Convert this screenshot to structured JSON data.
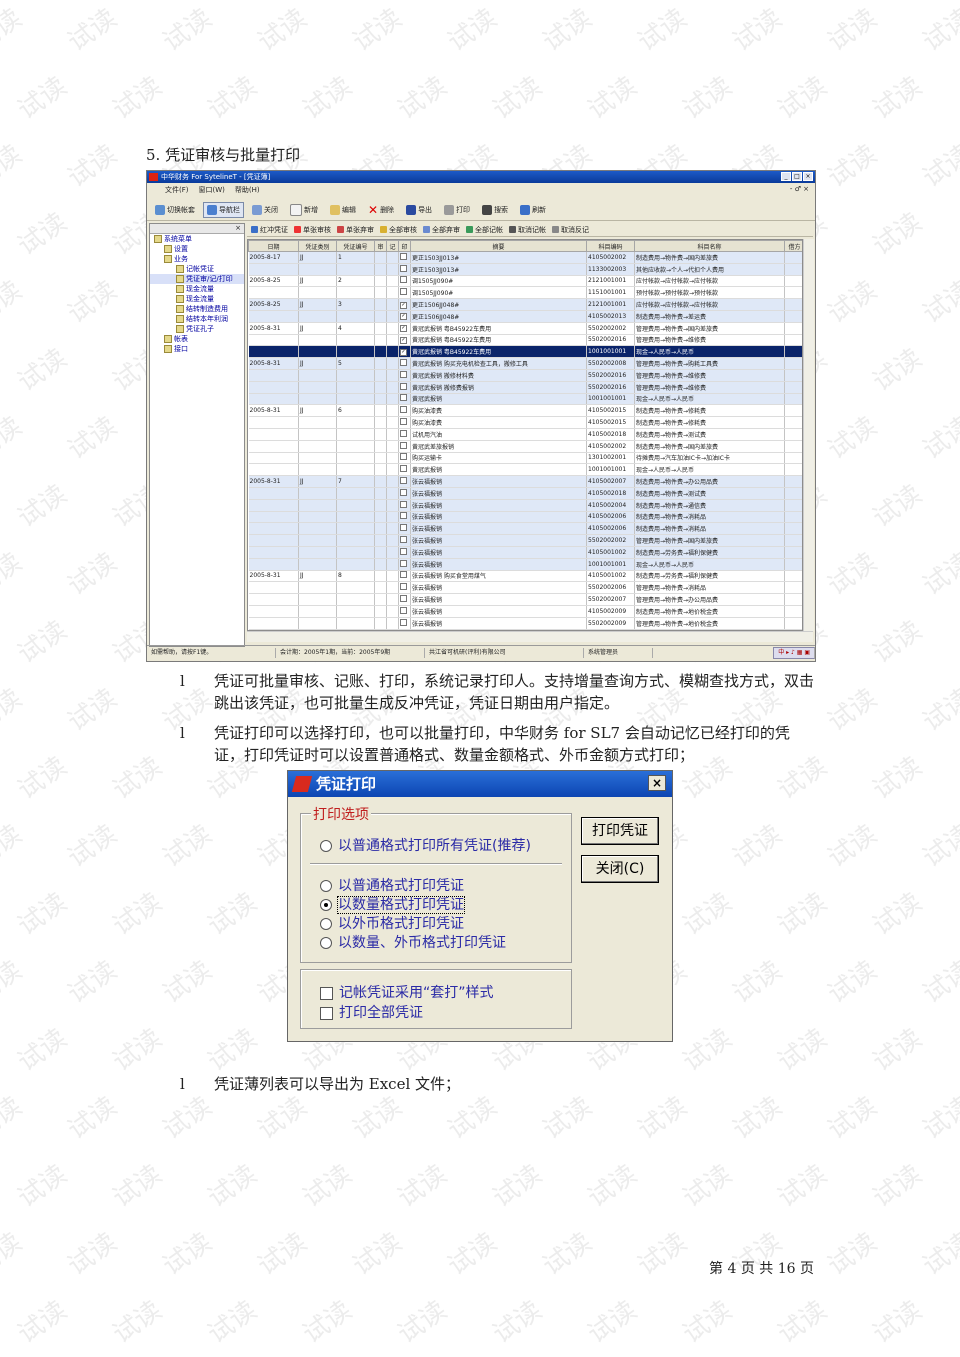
{
  "watermark": "试读",
  "heading": "5. 凭证审核与批量打印",
  "app": {
    "title": "中华财务 For SytelineT - [凭证簿]",
    "window_buttons": [
      "_",
      "□",
      "×"
    ],
    "menus": [
      "文件(F)",
      "窗口(W)",
      "帮助(H)"
    ],
    "mdi_buttons": "- ♂ ×",
    "toolbar": [
      "切换帐套",
      "导航栏",
      "关闭",
      "新增",
      "编辑",
      "删除",
      "导出",
      "打印",
      "搜索",
      "刷新"
    ],
    "sidebar": {
      "close": "×",
      "tree": [
        {
          "label": "系统菜单",
          "level": 1
        },
        {
          "label": "设置",
          "level": 2
        },
        {
          "label": "业务",
          "level": 2
        },
        {
          "label": "记帐凭证",
          "level": 3
        },
        {
          "label": "凭证审/记/打印",
          "level": 3
        },
        {
          "label": "现金流量",
          "level": 3
        },
        {
          "label": "现金流量",
          "level": 3
        },
        {
          "label": "结转制造费用",
          "level": 3
        },
        {
          "label": "结转本年利润",
          "level": 3
        },
        {
          "label": "凭证孔子",
          "level": 3
        },
        {
          "label": "帐表",
          "level": 2
        },
        {
          "label": "接口",
          "level": 2
        }
      ]
    },
    "toolbar2": [
      "红冲凭证",
      "单张审核",
      "单张弃审",
      "全部审核",
      "全部弃审",
      "全部记帐",
      "取消记帐",
      "取消反记"
    ],
    "columns": [
      "日期",
      "凭证类别",
      "凭证编号",
      "审",
      "记",
      "印",
      "摘要",
      "科目编码",
      "科目名称",
      "借方"
    ],
    "rows": [
      {
        "date": "2005-8-17",
        "type": "JJ",
        "no": "1",
        "check": "",
        "summary": "更正1503JJ013#",
        "code": "4105002002",
        "name": "制造费用→物件费→国内差旅费",
        "grp": true
      },
      {
        "date": "",
        "type": "",
        "no": "",
        "check": "",
        "summary": "更正1503JJ013#",
        "code": "1133002003",
        "name": "其他应收款→个人→代扣个人费用",
        "grp": true
      },
      {
        "date": "2005-8-25",
        "type": "JJ",
        "no": "2",
        "check": "",
        "summary": "调1505JJ090#",
        "code": "2121001001",
        "name": "应付帐款→应付帐款→应付帐款",
        "grp": false
      },
      {
        "date": "",
        "type": "",
        "no": "",
        "check": "",
        "summary": "调1505JJ090#",
        "code": "1151001001",
        "name": "预付帐款→预付帐款→预付帐款",
        "grp": false
      },
      {
        "date": "2005-8-25",
        "type": "JJ",
        "no": "3",
        "check": "✓",
        "summary": "更正1506JJ048#",
        "code": "2121001001",
        "name": "应付帐款→应付帐款→应付帐款",
        "grp": true
      },
      {
        "date": "",
        "type": "",
        "no": "",
        "check": "✓",
        "summary": "更正1506JJ048#",
        "code": "4105002013",
        "name": "制造费用→物件费→差运费",
        "grp": true
      },
      {
        "date": "2005-8-31",
        "type": "JJ",
        "no": "4",
        "check": "✓",
        "summary": "黄冠武报销 粤B45922车费用",
        "code": "5502002002",
        "name": "管理费用→物件费→国内差旅费",
        "grp": false
      },
      {
        "date": "",
        "type": "",
        "no": "",
        "check": "✓",
        "summary": "黄冠武报销 粤B45922车费用",
        "code": "5502002016",
        "name": "管理费用→物件费→维修费",
        "grp": false
      },
      {
        "date": "",
        "type": "",
        "no": "",
        "check": "✓",
        "summary": "黄冠武报销 粤B45922车费用",
        "code": "1001001001",
        "name": "现金→人民币→人民币",
        "grp": false,
        "hl": true
      },
      {
        "date": "2005-8-31",
        "type": "JJ",
        "no": "5",
        "check": "",
        "summary": "黄冠武报销 购买充电机检查工具，搬修工具",
        "code": "5502002008",
        "name": "管理费用→物件费→购耗工具费",
        "grp": true
      },
      {
        "date": "",
        "type": "",
        "no": "",
        "check": "",
        "summary": "黄冠武报销 搬修材料费",
        "code": "5502002016",
        "name": "管理费用→物件费→维修费",
        "grp": true
      },
      {
        "date": "",
        "type": "",
        "no": "",
        "check": "",
        "summary": "黄冠武报销 搬修费报销",
        "code": "5502002016",
        "name": "管理费用→物件费→维修费",
        "grp": true
      },
      {
        "date": "",
        "type": "",
        "no": "",
        "check": "",
        "summary": "黄冠武报销",
        "code": "1001001001",
        "name": "现金→人民币→人民币",
        "grp": true
      },
      {
        "date": "2005-8-31",
        "type": "JJ",
        "no": "6",
        "check": "",
        "summary": "购买油漆费",
        "code": "4105002015",
        "name": "制造费用→物件费→修耗费",
        "grp": false
      },
      {
        "date": "",
        "type": "",
        "no": "",
        "check": "",
        "summary": "购买油漆费",
        "code": "4105002015",
        "name": "制造费用→物件费→修耗费",
        "grp": false
      },
      {
        "date": "",
        "type": "",
        "no": "",
        "check": "",
        "summary": "试机用汽油",
        "code": "4105002018",
        "name": "制造费用→物件费→测试费",
        "grp": false
      },
      {
        "date": "",
        "type": "",
        "no": "",
        "check": "",
        "summary": "黄冠武差旅报销",
        "code": "4105002002",
        "name": "制造费用→物件费→国内差旅费",
        "grp": false
      },
      {
        "date": "",
        "type": "",
        "no": "",
        "check": "",
        "summary": "购买运输卡",
        "code": "1301002001",
        "name": "待摊费用→汽车加油IC卡→加油IC卡",
        "grp": false
      },
      {
        "date": "",
        "type": "",
        "no": "",
        "check": "",
        "summary": "黄冠武报销",
        "code": "1001001001",
        "name": "现金→人民币→人民币",
        "grp": false
      },
      {
        "date": "2005-8-31",
        "type": "JJ",
        "no": "7",
        "check": "",
        "summary": "张云福报销",
        "code": "4105002007",
        "name": "制造费用→物件费→办公用品费",
        "grp": true
      },
      {
        "date": "",
        "type": "",
        "no": "",
        "check": "",
        "summary": "张云福报销",
        "code": "4105002018",
        "name": "制造费用→物件费→测试费",
        "grp": true
      },
      {
        "date": "",
        "type": "",
        "no": "",
        "check": "",
        "summary": "张云福报销",
        "code": "4105002004",
        "name": "制造费用→物件费→通信费",
        "grp": true
      },
      {
        "date": "",
        "type": "",
        "no": "",
        "check": "",
        "summary": "张云福报销",
        "code": "4105002006",
        "name": "制造费用→物件费→消耗品",
        "grp": true
      },
      {
        "date": "",
        "type": "",
        "no": "",
        "check": "",
        "summary": "张云福报销",
        "code": "4105002006",
        "name": "制造费用→物件费→消耗品",
        "grp": true
      },
      {
        "date": "",
        "type": "",
        "no": "",
        "check": "",
        "summary": "张云福报销",
        "code": "5502002002",
        "name": "管理费用→物件费→国内差旅费",
        "grp": true
      },
      {
        "date": "",
        "type": "",
        "no": "",
        "check": "",
        "summary": "张云福报销",
        "code": "4105001002",
        "name": "制造费用→劳务费→福利保健费",
        "grp": true
      },
      {
        "date": "",
        "type": "",
        "no": "",
        "check": "",
        "summary": "张云福报销",
        "code": "1001001001",
        "name": "现金→人民币→人民币",
        "grp": true
      },
      {
        "date": "2005-8-31",
        "type": "JJ",
        "no": "8",
        "check": "",
        "summary": "张云福报销 购买食堂用煤气",
        "code": "4105001002",
        "name": "制造费用→劳务费→福利保健费",
        "grp": false
      },
      {
        "date": "",
        "type": "",
        "no": "",
        "check": "",
        "summary": "张云福报销",
        "code": "5502002006",
        "name": "管理费用→物件费→消耗品",
        "grp": false
      },
      {
        "date": "",
        "type": "",
        "no": "",
        "check": "",
        "summary": "张云福报销",
        "code": "5502002007",
        "name": "管理费用→物件费→办公用品费",
        "grp": false
      },
      {
        "date": "",
        "type": "",
        "no": "",
        "check": "",
        "summary": "张云福报销",
        "code": "4105002009",
        "name": "制造费用→物件费→地价税金费",
        "grp": false
      },
      {
        "date": "",
        "type": "",
        "no": "",
        "check": "",
        "summary": "张云福报销",
        "code": "5502002009",
        "name": "管理费用→物件费→地价税金费",
        "grp": false
      }
    ],
    "status": [
      "如需帮助，请按F1键。",
      "会计期：2005年1期，当前：2005年9期",
      "共江省可机研(评利)有限公司",
      "系统管理员",
      "中 ▸ ♪ ▦ ▣"
    ]
  },
  "bullets": [
    {
      "mark": "l",
      "text": "凭证可批量审核、记账、打印，系统记录打印人。支持增量查询方式、模糊查找方式，双击跳出该凭证，也可批量生成反冲凭证，凭证日期由用户指定。"
    },
    {
      "mark": "l",
      "text": "凭证打印可以选择打印，也可以批量打印，中华财务 for SL7 会自动记忆已经打印的凭证，打印凭证时可以设置普通格式、数量金额格式、外币金额方式打印；"
    },
    {
      "mark": "l",
      "text": "凭证薄列表可以导出为 Excel 文件；"
    }
  ],
  "dialog": {
    "title": "凭证打印",
    "close": "×",
    "group_label": "打印选项",
    "options": [
      {
        "label": "以普通格式打印所有凭证(推荐)",
        "checked": false
      },
      {
        "label": "以普通格式打印凭证",
        "checked": false
      },
      {
        "label": "以数量格式打印凭证",
        "checked": true
      },
      {
        "label": "以外币格式打印凭证",
        "checked": false
      },
      {
        "label": "以数量、外币格式打印凭证",
        "checked": false
      }
    ],
    "checkboxes": [
      {
        "label": "记帐凭证采用“套打”样式",
        "checked": false
      },
      {
        "label": "打印全部凭证",
        "checked": false
      }
    ],
    "print_button": "打印凭证",
    "close_button": "关闭(C)"
  },
  "footer": "第 4 页 共 16 页"
}
